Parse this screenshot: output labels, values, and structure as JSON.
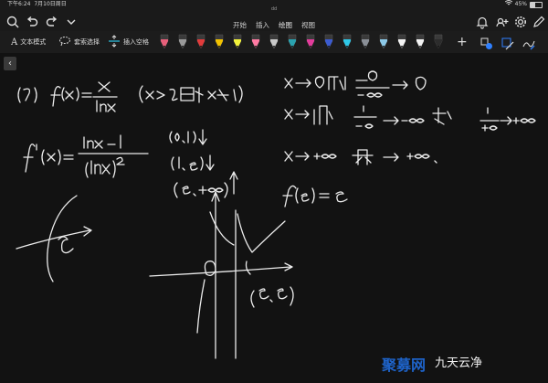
{
  "status": {
    "time": "下午6:24",
    "date": "7月10日周日",
    "doc_name": "dd",
    "battery": "45%",
    "battery_level": 0.45
  },
  "tabs": [
    {
      "label": "开始"
    },
    {
      "label": "插入"
    },
    {
      "label": "绘图",
      "active": true
    },
    {
      "label": "视图"
    }
  ],
  "toolbar": {
    "text_mode": "文本模式",
    "lasso": "套索选择",
    "insert_space": "插入空格"
  },
  "pens": [
    {
      "color": "#e85f7a"
    },
    {
      "color": "#9a9a9a"
    },
    {
      "color": "#e23b3b"
    },
    {
      "color": "#f2c200"
    },
    {
      "color": "#f3f33a"
    },
    {
      "color": "#ff7aa2"
    },
    {
      "color": "#c9c9c9"
    },
    {
      "color": "#2aa3b0"
    },
    {
      "color": "#e33b9b"
    },
    {
      "color": "#3b5bd0"
    },
    {
      "color": "#2ec8e8"
    },
    {
      "color": "#8a8f97"
    },
    {
      "color": "#8cc9e8"
    },
    {
      "color": "#f2f2f2"
    },
    {
      "color": "#f2f2f2"
    },
    {
      "color": "#2c2c2c"
    }
  ],
  "watermark": {
    "brand": "聚募网",
    "sub": "九天云净"
  }
}
